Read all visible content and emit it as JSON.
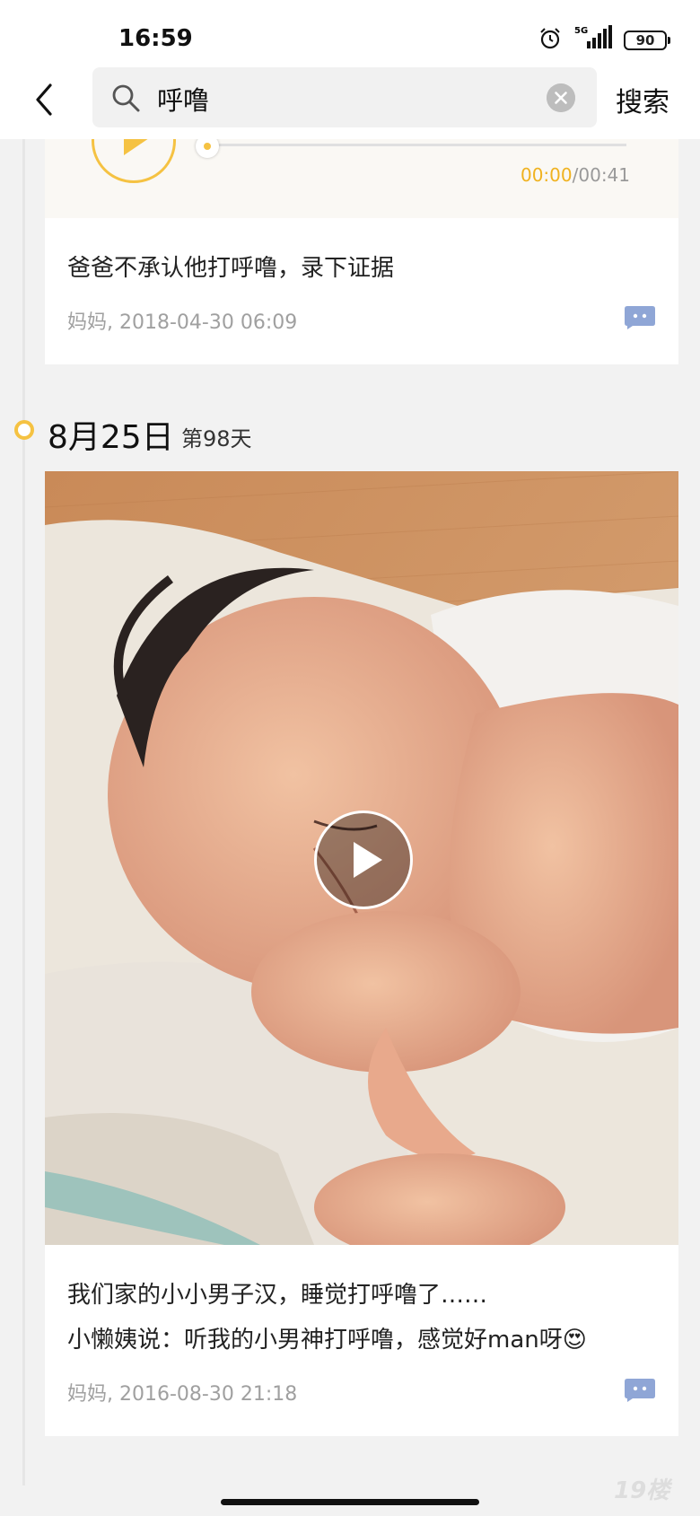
{
  "status_bar": {
    "time": "16:59",
    "battery": "90",
    "network": "5G"
  },
  "header": {
    "search_query": "呼噜",
    "search_button": "搜索"
  },
  "audio_player": {
    "current_time": "00:00",
    "duration": "/00:41",
    "progress": 0
  },
  "posts": [
    {
      "text": "爸爸不承认他打呼噜，录下证据",
      "meta": "妈妈, 2018-04-30 06:09"
    },
    {
      "text_line1": "我们家的小小男子汉，睡觉打呼噜了……",
      "text_line2": "小懒姨说：听我的小男神打呼噜，感觉好man呀😍",
      "meta": "妈妈, 2016-08-30 21:18"
    }
  ],
  "date_section": {
    "date": "8月25日",
    "day": "第98天"
  },
  "watermark": "19楼",
  "colors": {
    "accent": "#f5c242",
    "comment_icon": "#8fa6d6",
    "muted": "#a0a0a0"
  },
  "icons": [
    "back-icon",
    "search-icon",
    "clear-icon",
    "alarm-icon",
    "play-icon",
    "comment-icon"
  ]
}
